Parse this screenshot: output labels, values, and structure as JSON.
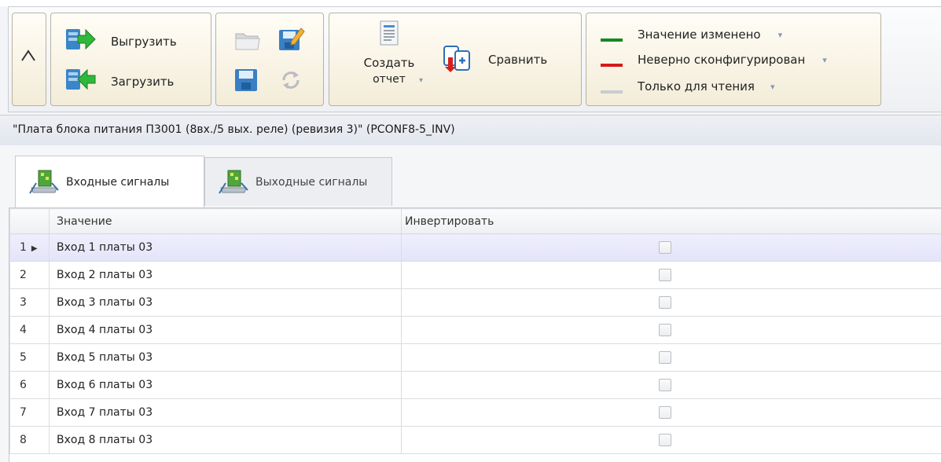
{
  "ribbon": {
    "collapse_glyph": "^",
    "upload_label": "Выгрузить",
    "download_label": "Загрузить",
    "report_label_line1": "Создать",
    "report_label_line2": "отчет",
    "compare_label": "Сравнить",
    "legend": [
      {
        "label": "Значение изменено",
        "color": "#148a1f"
      },
      {
        "label": "Неверно сконфигурирован",
        "color": "#d51a1a"
      },
      {
        "label": "Только для чтения",
        "color": "#c9cccf"
      }
    ]
  },
  "device_title": "\"Плата блока питания П3001 (8вх./5 вых. реле) (ревизия 3)\" (PCONF8-5_INV)",
  "tabs": [
    {
      "label": "Входные сигналы",
      "active": true
    },
    {
      "label": "Выходные сигналы",
      "active": false
    }
  ],
  "grid": {
    "columns": [
      "Значение",
      "Инвертировать"
    ],
    "rows": [
      {
        "num": "1",
        "value": "Вход 1 платы 03",
        "invert": false,
        "selected": true
      },
      {
        "num": "2",
        "value": "Вход 2 платы 03",
        "invert": false
      },
      {
        "num": "3",
        "value": "Вход 3 платы 03",
        "invert": false
      },
      {
        "num": "4",
        "value": "Вход 4 платы 03",
        "invert": false
      },
      {
        "num": "5",
        "value": "Вход 5 платы 03",
        "invert": false
      },
      {
        "num": "6",
        "value": "Вход 6 платы 03",
        "invert": false
      },
      {
        "num": "7",
        "value": "Вход 7 платы 03",
        "invert": false
      },
      {
        "num": "8",
        "value": "Вход 8 платы 03",
        "invert": false
      }
    ]
  }
}
